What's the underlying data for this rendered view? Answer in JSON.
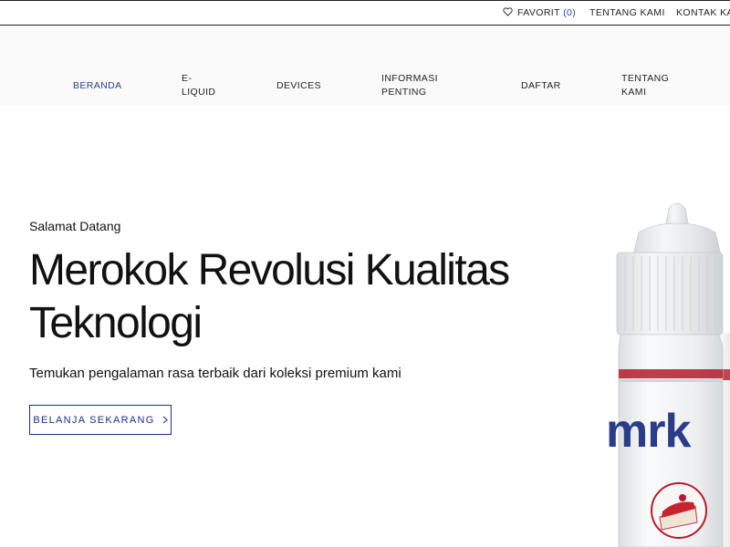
{
  "topbar": {
    "favorites_label": "FAVORIT",
    "favorites_count": "(0)",
    "about_label": "TENTANG KAMI",
    "contact_label": "KONTAK KAMI"
  },
  "nav": {
    "items": [
      {
        "label": "BERANDA",
        "active": true
      },
      {
        "label": "E-LIQUID"
      },
      {
        "label": "DEVICES"
      },
      {
        "label": "INFORMASI PENTING"
      },
      {
        "label": "DAFTAR"
      },
      {
        "label": "TENTANG KAMI"
      }
    ]
  },
  "hero": {
    "kicker": "Salamat Datang",
    "title": "Merokok Revolusi Kualitas Teknologi",
    "subtitle": "Temukan pengalaman rasa terbaik dari koleksi premium kami",
    "cta_label": "BELANJA SEKARANG",
    "product_brand": "mrk"
  },
  "colors": {
    "accent": "#1d2f86",
    "nav_active": "#2d3e8c",
    "text": "#111111",
    "nav_bg": "#fafafa"
  },
  "icons": {
    "favorites": "heart-outline-icon",
    "cta": "chevron-right-icon"
  }
}
